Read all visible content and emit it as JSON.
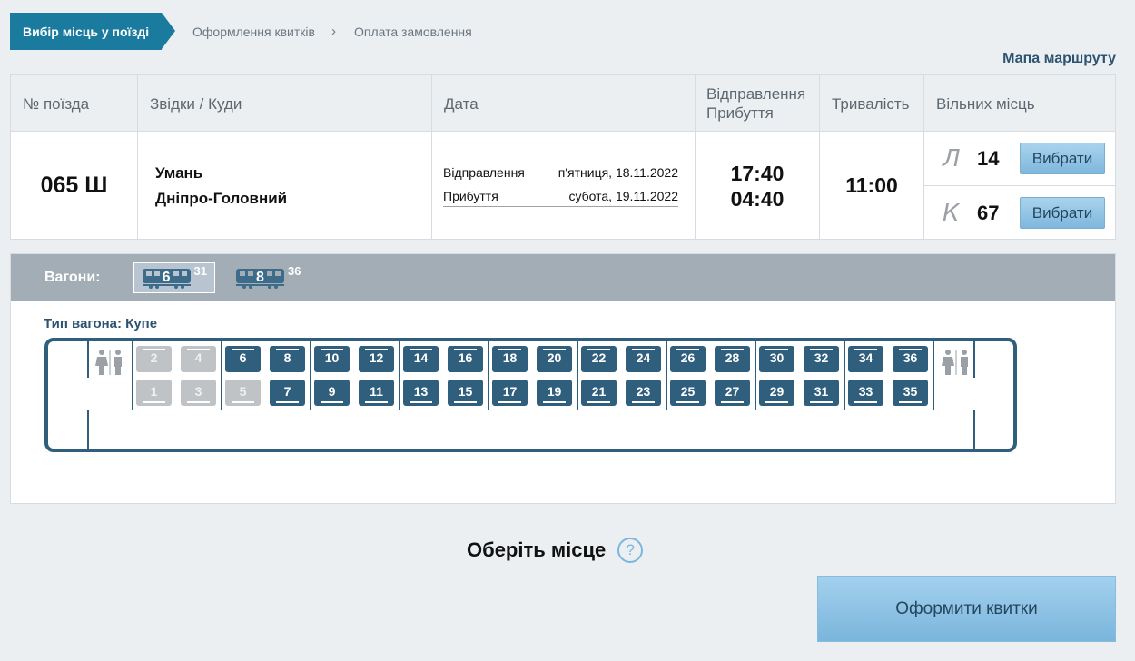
{
  "steps": {
    "active": "Вибір місць у поїзді",
    "second": "Оформлення квитків",
    "third": "Оплата замовлення"
  },
  "route_map_link": "Мапа маршруту",
  "table": {
    "headers": {
      "number": "№ поїзда",
      "route": "Звідки / Куди",
      "date": "Дата",
      "times_line1": "Відправлення",
      "times_line2": "Прибуття",
      "duration": "Тривалість",
      "free": "Вільних місць"
    },
    "row": {
      "number": "065 Ш",
      "from": "Умань",
      "to": "Дніпро-Головний",
      "departure_label": "Відправлення",
      "departure_date": "п'ятниця, 18.11.2022",
      "arrival_label": "Прибуття",
      "arrival_date": "субота, 19.11.2022",
      "departure_time": "17:40",
      "arrival_time": "04:40",
      "duration": "11:00",
      "classes": [
        {
          "code": "Л",
          "count": "14",
          "button": "Вибрати"
        },
        {
          "code": "К",
          "count": "67",
          "button": "Вибрати"
        }
      ]
    }
  },
  "wagons": {
    "label": "Вагони:",
    "items": [
      {
        "number": "6",
        "free": "31",
        "selected": true
      },
      {
        "number": "8",
        "free": "36",
        "selected": false
      }
    ],
    "type_label": "Тип вагона: Купе"
  },
  "seats": {
    "upper": [
      "2",
      "4",
      "6",
      "8",
      "10",
      "12",
      "14",
      "16",
      "18",
      "20",
      "22",
      "24",
      "26",
      "28",
      "30",
      "32",
      "34",
      "36"
    ],
    "lower": [
      "1",
      "3",
      "5",
      "7",
      "9",
      "11",
      "13",
      "15",
      "17",
      "19",
      "21",
      "23",
      "25",
      "27",
      "29",
      "31",
      "33",
      "35"
    ],
    "busy": [
      "1",
      "2",
      "3",
      "4",
      "5"
    ]
  },
  "colors": {
    "accent": "#1a7b9e",
    "seat_free": "#2f5f7c",
    "seat_busy": "#bfc3c6",
    "button": "#8fc3e4"
  },
  "icons": {
    "wagon": "train-car-icon",
    "wc": "restroom-icon",
    "help": "question-circle-icon",
    "separator": "chevron-right-icon"
  },
  "choose_seat_text": "Оберіть місце",
  "help_symbol": "?",
  "submit_button": "Оформити квитки"
}
